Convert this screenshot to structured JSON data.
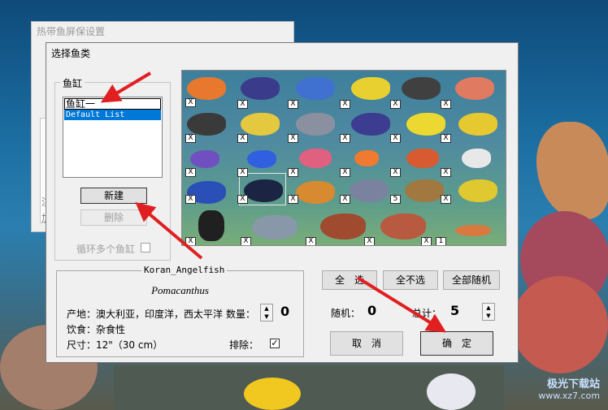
{
  "background_window": {
    "title": "热带鱼屏保设置",
    "partial_text": "注\n加"
  },
  "dialog": {
    "title": "选择鱼类",
    "tank_group": {
      "legend": "鱼缸",
      "edit_value": "鱼缸一",
      "selected_item": "Default List",
      "new_button": "新建",
      "delete_button": "删除",
      "loop_label": "循环多个鱼缸"
    },
    "fish_panel": {
      "tags": [
        "X",
        "X",
        "X",
        "X",
        "X",
        "X",
        "X",
        "X",
        "X",
        "X",
        "X",
        "X",
        "X",
        "X",
        "X",
        "X",
        "X",
        "X",
        "X",
        "X",
        "X",
        "X",
        "X",
        "5",
        "X",
        "X",
        "X",
        "X",
        "X",
        "X",
        "1"
      ]
    },
    "info": {
      "legend": "Koran_Angelfish",
      "latin": "Pomacanthus",
      "origin": "产地：澳大利亚，印度洋，西太平洋",
      "count_label": "数量：",
      "count_value": "0",
      "food": "饮食：杂食性",
      "size": "尺寸：12\"（30 cm）",
      "exclude_label": "排除：",
      "exclude_checked": "✓"
    },
    "buttons": {
      "select_all": "全　选",
      "select_none": "全不选",
      "all_random": "全部随机",
      "cancel": "取　消",
      "ok": "确　定"
    },
    "random": {
      "label": "随机：",
      "value": "0"
    },
    "total": {
      "label": "总计：",
      "value": "5"
    }
  },
  "watermark": {
    "line1": "极光下载站",
    "line2": "www.xz7.com"
  },
  "colors": {
    "arrow": "#e02020",
    "selection": "#0078d7"
  }
}
